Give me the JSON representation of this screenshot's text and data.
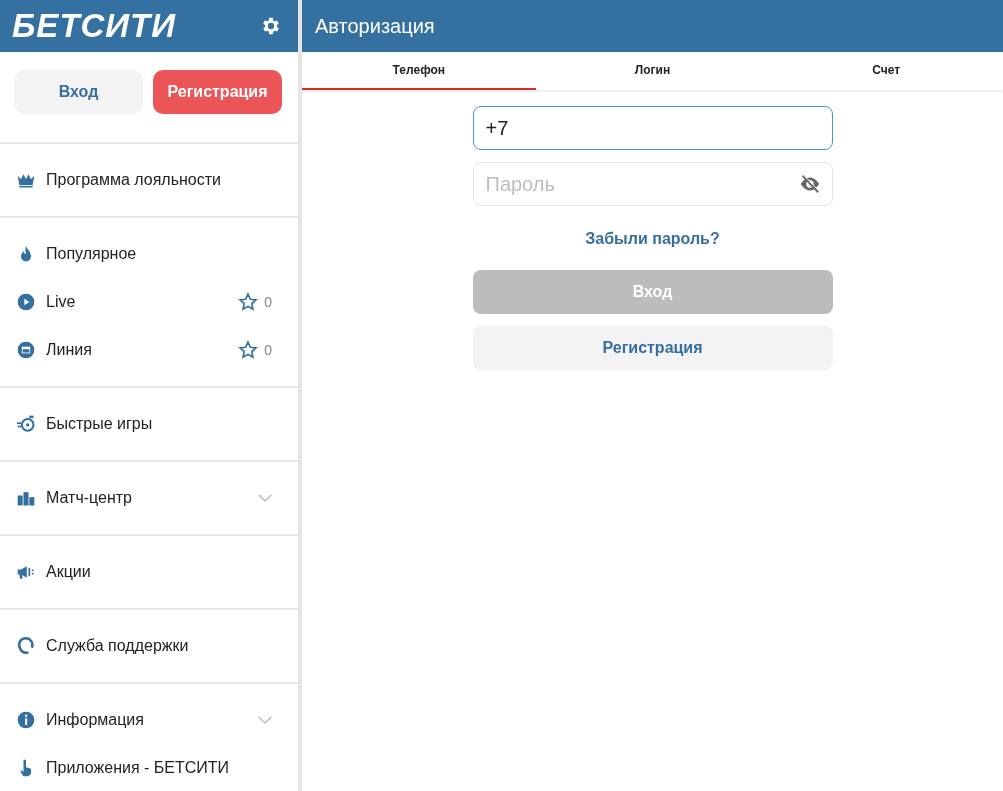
{
  "sidebar": {
    "logo": "БЕТСИТИ",
    "buttons": [
      {
        "label": "Вход",
        "kind": "secondary"
      },
      {
        "label": "Регистрация",
        "kind": "primary"
      }
    ],
    "groups": [
      {
        "items": [
          {
            "label": "Программа лояльности"
          }
        ]
      },
      {
        "items": [
          {
            "label": "Популярное"
          },
          {
            "label": "Live",
            "favorites": "0"
          },
          {
            "label": "Линия",
            "favorites": "0"
          }
        ]
      },
      {
        "items": [
          {
            "label": "Быстрые игры"
          }
        ]
      },
      {
        "items": [
          {
            "label": "Матч-центр",
            "expanded": false
          }
        ]
      },
      {
        "items": [
          {
            "label": "Акции"
          }
        ]
      },
      {
        "items": [
          {
            "label": "Служба поддержки"
          }
        ]
      },
      {
        "items": [
          {
            "label": "Информация",
            "expanded": false
          },
          {
            "label": "Приложения - БЕТСИТИ"
          }
        ]
      }
    ]
  },
  "main": {
    "title": "Авторизация",
    "tabs": [
      {
        "label": "Телефон",
        "selected": true
      },
      {
        "label": "Логин",
        "selected": false
      },
      {
        "label": "Счет",
        "selected": false
      }
    ],
    "phone": {
      "value": "+7"
    },
    "password": {
      "placeholder": "Пароль"
    },
    "forgot_link": "Забыли пароль?",
    "login_button": {
      "label": "Вход",
      "disabled": true
    },
    "register_button": {
      "label": "Регистрация"
    }
  }
}
